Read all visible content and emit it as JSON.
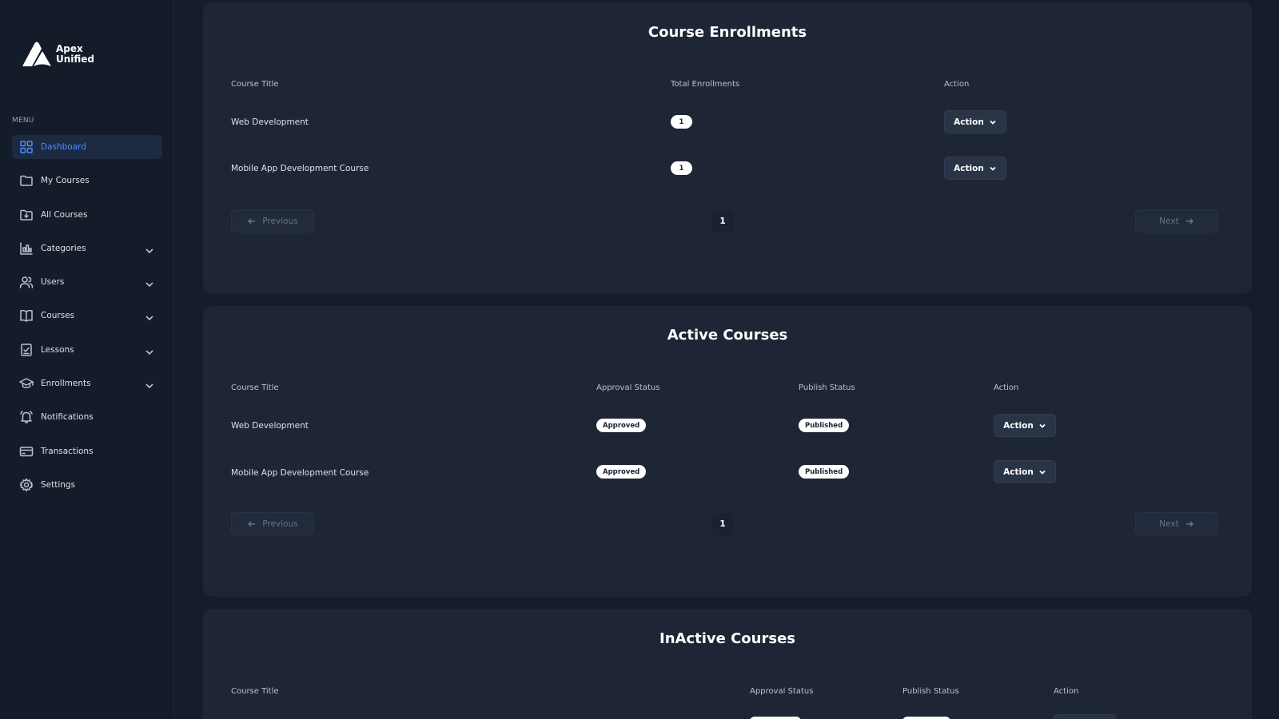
{
  "brand": {
    "line1": "Apex",
    "line2": "Unified",
    "accent": "#4c8dff"
  },
  "menu": {
    "title": "MENU",
    "items": [
      {
        "label": "Dashboard",
        "icon": "grid-icon",
        "active": true,
        "expandable": false
      },
      {
        "label": "My Courses",
        "icon": "folder-icon",
        "active": false,
        "expandable": false
      },
      {
        "label": "All Courses",
        "icon": "folder-download-icon",
        "active": false,
        "expandable": false
      },
      {
        "label": "Categories",
        "icon": "chart-icon",
        "active": false,
        "expandable": true
      },
      {
        "label": "Users",
        "icon": "users-icon",
        "active": false,
        "expandable": true
      },
      {
        "label": "Courses",
        "icon": "book-icon",
        "active": false,
        "expandable": true
      },
      {
        "label": "Lessons",
        "icon": "clipboard-check-icon",
        "active": false,
        "expandable": true
      },
      {
        "label": "Enrollments",
        "icon": "graduation-cap-icon",
        "active": false,
        "expandable": true
      },
      {
        "label": "Notifications",
        "icon": "bell-icon",
        "active": false,
        "expandable": false
      },
      {
        "label": "Transactions",
        "icon": "credit-card-icon",
        "active": false,
        "expandable": false
      },
      {
        "label": "Settings",
        "icon": "gear-icon",
        "active": false,
        "expandable": false
      }
    ]
  },
  "enrollments": {
    "title": "Course Enrollments",
    "columns": [
      "Course Title",
      "Total Enrollments",
      "Action"
    ],
    "rows": [
      {
        "title": "Web Development",
        "count": "1",
        "action": "Action"
      },
      {
        "title": "Mobile App Development Course",
        "count": "1",
        "action": "Action"
      }
    ],
    "pagination": {
      "prev": "Previous",
      "page": "1",
      "next": "Next"
    }
  },
  "active": {
    "title": "Active Courses",
    "columns": [
      "Course Title",
      "Approval Status",
      "Publish Status",
      "Action"
    ],
    "rows": [
      {
        "title": "Web Development",
        "approval": "Approved",
        "publish": "Published",
        "action": "Action"
      },
      {
        "title": "Mobile App Development Course",
        "approval": "Approved",
        "publish": "Published",
        "action": "Action"
      }
    ],
    "pagination": {
      "prev": "Previous",
      "page": "1",
      "next": "Next"
    }
  },
  "inactive": {
    "title": "InActive Courses",
    "columns": [
      "Course Title",
      "Approval Status",
      "Publish Status",
      "Action"
    ]
  }
}
